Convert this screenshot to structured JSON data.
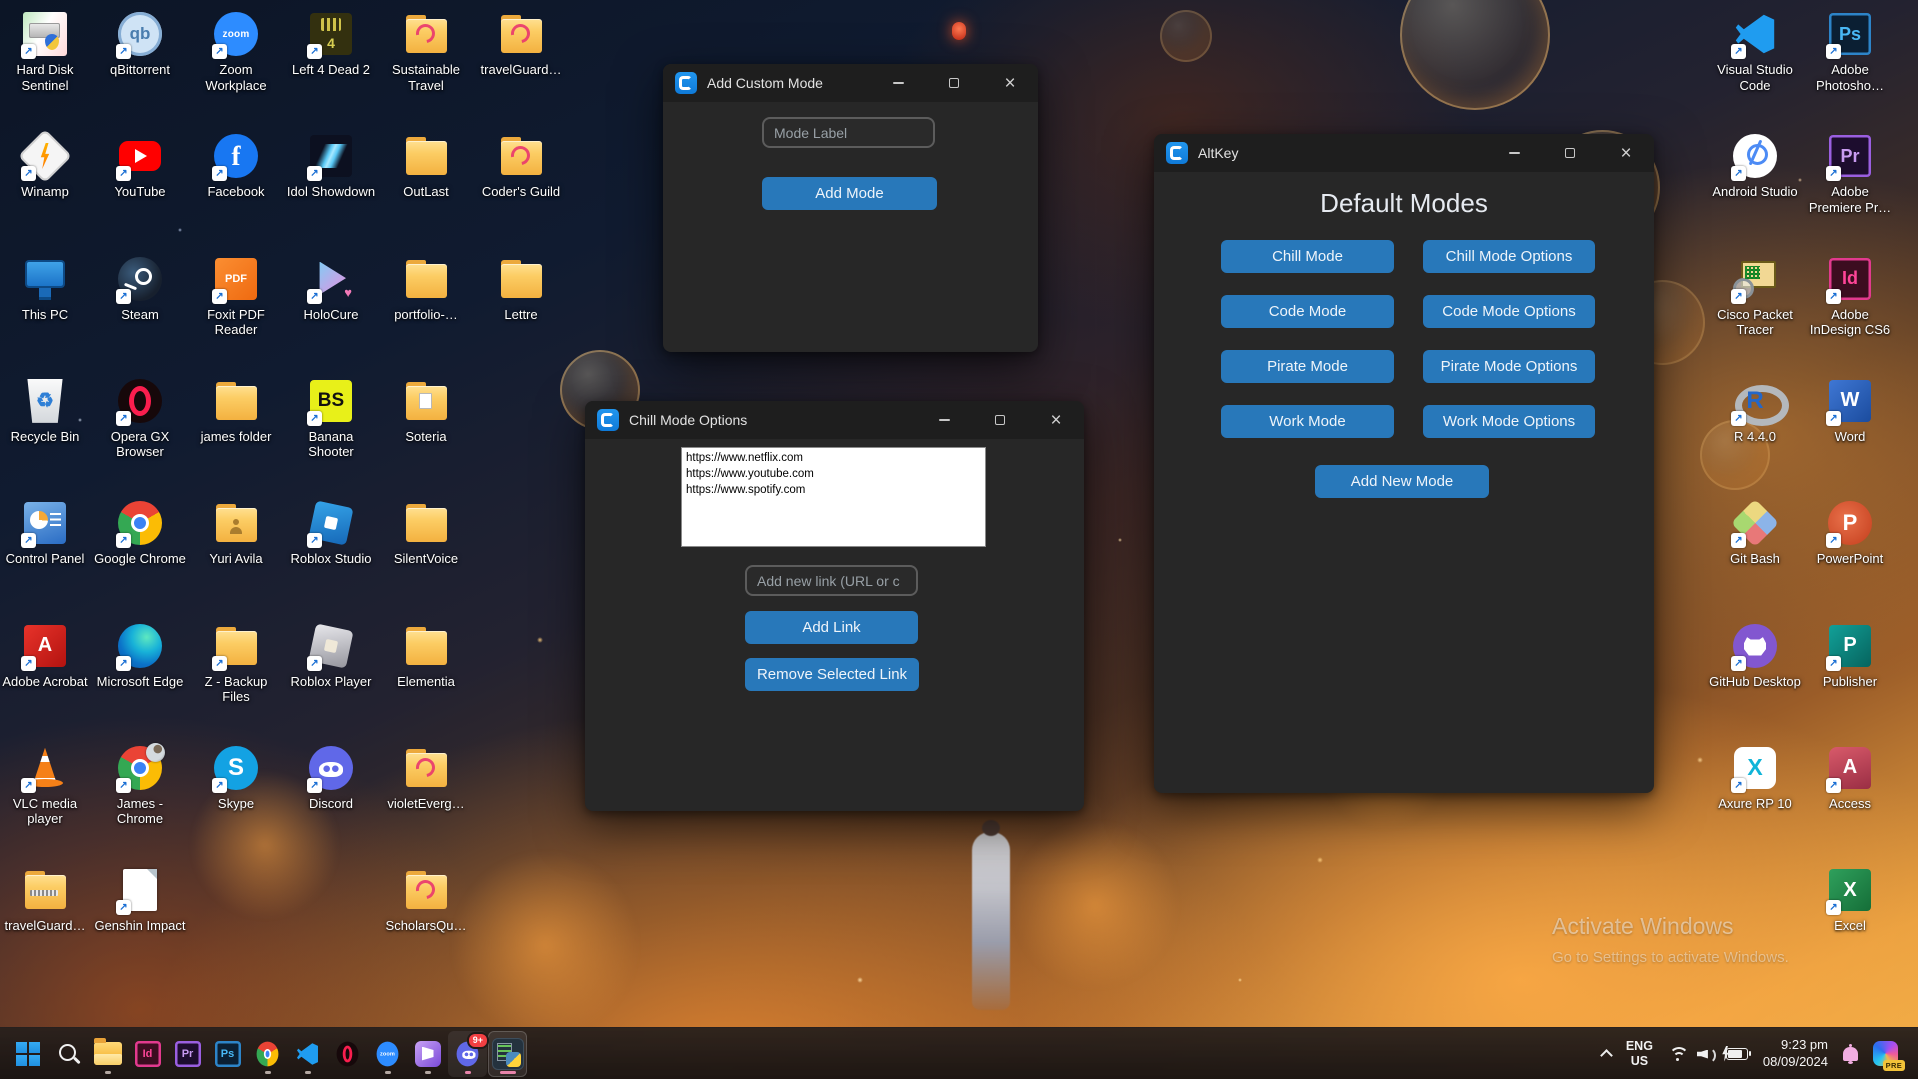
{
  "theme": {
    "accent_blue": "#2878BA",
    "titlebar_icon_blue": "#1287E8"
  },
  "desktop": {
    "icons": [
      {
        "label": "Hard Disk Sentinel",
        "icon": "harddisk-sentinel-icon",
        "side": "left",
        "col": 0,
        "row": 0,
        "shortcut": true
      },
      {
        "label": "qBittorrent",
        "icon": "qbittorrent-icon",
        "side": "left",
        "col": 1,
        "row": 0,
        "shortcut": true
      },
      {
        "label": "Zoom Workplace",
        "icon": "zoom-icon",
        "side": "left",
        "col": 2,
        "row": 0,
        "shortcut": true
      },
      {
        "label": "Left 4 Dead 2",
        "icon": "left4dead2-icon",
        "side": "left",
        "col": 3,
        "row": 0,
        "shortcut": true
      },
      {
        "label": "Sustainable Travel",
        "icon": "folder-swirl-icon",
        "side": "left",
        "col": 4,
        "row": 0,
        "shortcut": false
      },
      {
        "label": "travelGuard…",
        "icon": "folder-swirl-icon",
        "side": "left",
        "col": 5,
        "row": 0,
        "shortcut": false
      },
      {
        "label": "Winamp",
        "icon": "winamp-icon",
        "side": "left",
        "col": 0,
        "row": 1,
        "shortcut": true
      },
      {
        "label": "YouTube",
        "icon": "youtube-icon",
        "side": "left",
        "col": 1,
        "row": 1,
        "shortcut": true
      },
      {
        "label": "Facebook",
        "icon": "facebook-icon",
        "side": "left",
        "col": 2,
        "row": 1,
        "shortcut": true
      },
      {
        "label": "Idol Showdown",
        "icon": "idol-showdown-icon",
        "side": "left",
        "col": 3,
        "row": 1,
        "shortcut": true
      },
      {
        "label": "OutLast",
        "icon": "folder-icon",
        "side": "left",
        "col": 4,
        "row": 1,
        "shortcut": false
      },
      {
        "label": "Coder's Guild",
        "icon": "folder-swirl-icon",
        "side": "left",
        "col": 5,
        "row": 1,
        "shortcut": false
      },
      {
        "label": "This PC",
        "icon": "this-pc-icon",
        "side": "left",
        "col": 0,
        "row": 2,
        "shortcut": false
      },
      {
        "label": "Steam",
        "icon": "steam-icon",
        "side": "left",
        "col": 1,
        "row": 2,
        "shortcut": true
      },
      {
        "label": "Foxit PDF Reader",
        "icon": "foxit-icon",
        "side": "left",
        "col": 2,
        "row": 2,
        "shortcut": true
      },
      {
        "label": "HoloCure",
        "icon": "holocure-icon",
        "side": "left",
        "col": 3,
        "row": 2,
        "shortcut": true
      },
      {
        "label": "portfolio-…",
        "icon": "folder-icon",
        "side": "left",
        "col": 4,
        "row": 2,
        "shortcut": false
      },
      {
        "label": "Lettre",
        "icon": "folder-icon",
        "side": "left",
        "col": 5,
        "row": 2,
        "shortcut": false
      },
      {
        "label": "Recycle Bin",
        "icon": "recycle-bin-icon",
        "side": "left",
        "col": 0,
        "row": 3,
        "shortcut": false
      },
      {
        "label": "Opera GX Browser",
        "icon": "opera-gx-icon",
        "side": "left",
        "col": 1,
        "row": 3,
        "shortcut": true
      },
      {
        "label": "james folder",
        "icon": "folder-icon",
        "side": "left",
        "col": 2,
        "row": 3,
        "shortcut": false
      },
      {
        "label": "Banana Shooter",
        "icon": "banana-shooter-icon",
        "side": "left",
        "col": 3,
        "row": 3,
        "shortcut": true
      },
      {
        "label": "Soteria",
        "icon": "folder-paper-icon",
        "side": "left",
        "col": 4,
        "row": 3,
        "shortcut": false
      },
      {
        "label": "Control Panel",
        "icon": "control-panel-icon",
        "side": "left",
        "col": 0,
        "row": 4,
        "shortcut": true
      },
      {
        "label": "Google Chrome",
        "icon": "chrome-icon",
        "side": "left",
        "col": 1,
        "row": 4,
        "shortcut": true
      },
      {
        "label": "Yuri Avila",
        "icon": "folder-person-icon",
        "side": "left",
        "col": 2,
        "row": 4,
        "shortcut": false
      },
      {
        "label": "Roblox Studio",
        "icon": "roblox-studio-icon",
        "side": "left",
        "col": 3,
        "row": 4,
        "shortcut": true
      },
      {
        "label": "SilentVoice",
        "icon": "folder-icon",
        "side": "left",
        "col": 4,
        "row": 4,
        "shortcut": false
      },
      {
        "label": "Adobe Acrobat",
        "icon": "acrobat-icon",
        "side": "left",
        "col": 0,
        "row": 5,
        "shortcut": true
      },
      {
        "label": "Microsoft Edge",
        "icon": "edge-icon",
        "side": "left",
        "col": 1,
        "row": 5,
        "shortcut": true
      },
      {
        "label": "Z - Backup Files",
        "icon": "folder-icon",
        "side": "left",
        "col": 2,
        "row": 5,
        "shortcut": true
      },
      {
        "label": "Roblox Player",
        "icon": "roblox-player-icon",
        "side": "left",
        "col": 3,
        "row": 5,
        "shortcut": true
      },
      {
        "label": "Elementia",
        "icon": "folder-icon",
        "side": "left",
        "col": 4,
        "row": 5,
        "shortcut": false
      },
      {
        "label": "VLC media player",
        "icon": "vlc-icon",
        "side": "left",
        "col": 0,
        "row": 6,
        "shortcut": true
      },
      {
        "label": "James - Chrome",
        "icon": "james-chrome-icon",
        "side": "left",
        "col": 1,
        "row": 6,
        "shortcut": true
      },
      {
        "label": "Skype",
        "icon": "skype-icon",
        "side": "left",
        "col": 2,
        "row": 6,
        "shortcut": true
      },
      {
        "label": "Discord",
        "icon": "discord-icon",
        "side": "left",
        "col": 3,
        "row": 6,
        "shortcut": true
      },
      {
        "label": "violetEverg…",
        "icon": "folder-swirl-icon",
        "side": "left",
        "col": 4,
        "row": 6,
        "shortcut": false
      },
      {
        "label": "travelGuard…",
        "icon": "folder-zip-icon",
        "side": "left",
        "col": 0,
        "row": 7,
        "shortcut": false
      },
      {
        "label": "Genshin Impact",
        "icon": "genshin-doc-icon",
        "side": "left",
        "col": 1,
        "row": 7,
        "shortcut": true
      },
      {
        "label": "ScholarsQu…",
        "icon": "folder-swirl-icon",
        "side": "left",
        "col": 4,
        "row": 7,
        "shortcut": false
      },
      {
        "label": "Visual Studio Code",
        "icon": "vscode-icon",
        "side": "right",
        "col": 0,
        "row": 0,
        "shortcut": true
      },
      {
        "label": "Adobe Photosho…",
        "icon": "photoshop-icon",
        "side": "right",
        "col": 1,
        "row": 0,
        "shortcut": true
      },
      {
        "label": "Android Studio",
        "icon": "android-studio-icon",
        "side": "right",
        "col": 0,
        "row": 1,
        "shortcut": true
      },
      {
        "label": "Adobe Premiere Pr…",
        "icon": "premiere-icon",
        "side": "right",
        "col": 1,
        "row": 1,
        "shortcut": true
      },
      {
        "label": "Cisco Packet Tracer",
        "icon": "cisco-pt-icon",
        "side": "right",
        "col": 0,
        "row": 2,
        "shortcut": true
      },
      {
        "label": "Adobe InDesign CS6",
        "icon": "indesign-icon",
        "side": "right",
        "col": 1,
        "row": 2,
        "shortcut": true
      },
      {
        "label": "R 4.4.0",
        "icon": "r-icon",
        "side": "right",
        "col": 0,
        "row": 3,
        "shortcut": true
      },
      {
        "label": "Word",
        "icon": "word-icon",
        "side": "right",
        "col": 1,
        "row": 3,
        "shortcut": true
      },
      {
        "label": "Git Bash",
        "icon": "gitbash-icon",
        "side": "right",
        "col": 0,
        "row": 4,
        "shortcut": true
      },
      {
        "label": "PowerPoint",
        "icon": "powerpoint-icon",
        "side": "right",
        "col": 1,
        "row": 4,
        "shortcut": true
      },
      {
        "label": "GitHub Desktop",
        "icon": "github-desktop-icon",
        "side": "right",
        "col": 0,
        "row": 5,
        "shortcut": true
      },
      {
        "label": "Publisher",
        "icon": "publisher-icon",
        "side": "right",
        "col": 1,
        "row": 5,
        "shortcut": true
      },
      {
        "label": "Axure RP 10",
        "icon": "axure-icon",
        "side": "right",
        "col": 0,
        "row": 6,
        "shortcut": true
      },
      {
        "label": "Access",
        "icon": "access-icon",
        "side": "right",
        "col": 1,
        "row": 6,
        "shortcut": true
      },
      {
        "label": "Excel",
        "icon": "excel-icon",
        "side": "right",
        "col": 1,
        "row": 7,
        "shortcut": true
      }
    ]
  },
  "windows": {
    "add_custom_mode": {
      "title": "Add Custom Mode",
      "mode_label_placeholder": "Mode Label",
      "add_mode_button": "Add Mode"
    },
    "chill_mode_options": {
      "title": "Chill Mode Options",
      "links": [
        "https://www.netflix.com",
        "https://www.youtube.com",
        "https://www.spotify.com"
      ],
      "add_link_placeholder": "Add new link (URL or c",
      "add_link_button": "Add Link",
      "remove_link_button": "Remove Selected Link"
    },
    "altkey": {
      "title": "AltKey",
      "heading": "Default Modes",
      "mode_buttons": [
        "Chill Mode",
        "Chill Mode Options",
        "Code Mode",
        "Code Mode Options",
        "Pirate Mode",
        "Pirate Mode Options",
        "Work Mode",
        "Work Mode Options"
      ],
      "add_new_mode_button": "Add New Mode"
    }
  },
  "taskbar": {
    "apps": [
      {
        "name": "start"
      },
      {
        "name": "search"
      },
      {
        "name": "file-explorer",
        "running": true
      },
      {
        "name": "indesign"
      },
      {
        "name": "premiere"
      },
      {
        "name": "photoshop"
      },
      {
        "name": "chrome",
        "running": true
      },
      {
        "name": "vscode",
        "running": true
      },
      {
        "name": "opera-gx"
      },
      {
        "name": "zoom",
        "running": true
      },
      {
        "name": "clipchamp",
        "running": true
      },
      {
        "name": "discord",
        "running": true,
        "badge": "9+",
        "highlight": true
      },
      {
        "name": "python-altkey",
        "active": true
      }
    ]
  },
  "tray": {
    "language_line1": "ENG",
    "language_line2": "US",
    "time": "9:23 pm",
    "date": "08/09/2024",
    "copilot_badge": "PRE"
  },
  "watermark": {
    "line1": "Activate Windows",
    "line2": "Go to Settings to activate Windows."
  }
}
